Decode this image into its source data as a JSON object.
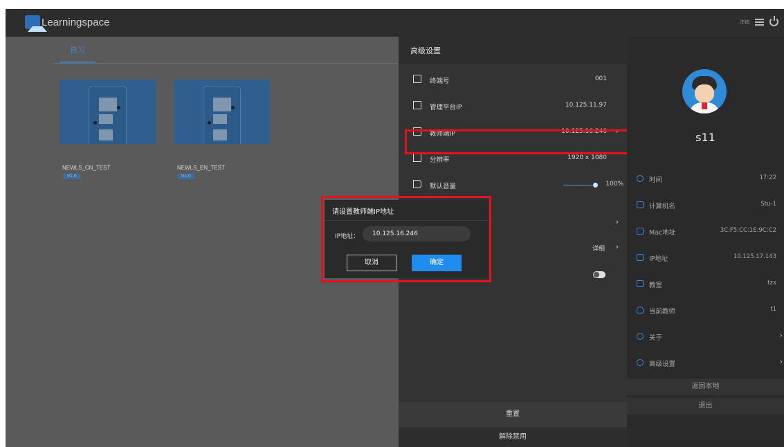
{
  "app": {
    "logo_text": "Learningspace",
    "top_small": "注销"
  },
  "left": {
    "tab": "自习",
    "cards": [
      {
        "title": "NEWLS_CN_TEST",
        "badge": "V1.0"
      },
      {
        "title": "NEWLS_EN_TEST",
        "badge": "V1.0"
      }
    ]
  },
  "settings": {
    "title": "高级设置",
    "rows": [
      {
        "icon": "monitor-icon",
        "label": "终端号",
        "value": "001"
      },
      {
        "icon": "upload-icon",
        "label": "管理平台IP",
        "value": "10.125.11.97"
      },
      {
        "icon": "teacher-icon",
        "label": "教师端IP",
        "value": "10.125.16.246",
        "chevron": "›"
      },
      {
        "icon": "resolution-icon",
        "label": "分辨率",
        "value": "1920 x 1080"
      },
      {
        "icon": "volume-icon",
        "label": "默认音量",
        "value": "100%"
      }
    ],
    "row_more_chevron": "›",
    "detail_label": "详细",
    "detail_chevron": "›",
    "reset_label": "重置",
    "unlock_label": "解除禁用"
  },
  "dialog": {
    "title": "请设置教师端IP地址",
    "ip_label": "IP地址：",
    "ip_value": "10.125.16.246",
    "cancel": "取消",
    "ok": "确定"
  },
  "profile": {
    "name": "s11",
    "rows": [
      {
        "icon": "clock-icon",
        "label": "时间",
        "value": "17:22"
      },
      {
        "icon": "computer-icon",
        "label": "计算机名",
        "value": "Stu-1"
      },
      {
        "icon": "barcode-icon",
        "label": "Mac地址",
        "value": "3C:F5:CC:1E:9C:C2"
      },
      {
        "icon": "ip-icon",
        "label": "IP地址",
        "value": "10.125.17.143"
      },
      {
        "icon": "home-icon",
        "label": "教室",
        "value": "tzx"
      },
      {
        "icon": "user-icon",
        "label": "当前教师",
        "value": "t1"
      },
      {
        "icon": "info-icon",
        "label": "关于",
        "value": "",
        "chevron": "›"
      },
      {
        "icon": "settings-icon",
        "label": "高级设置",
        "value": "",
        "chevron": "›"
      }
    ],
    "back_local": "返回本地",
    "logout": "退出"
  },
  "colors": {
    "accent": "#1f8df0",
    "highlight": "#e2131c",
    "panel": "#333333",
    "topbar": "#2d2d2d"
  }
}
